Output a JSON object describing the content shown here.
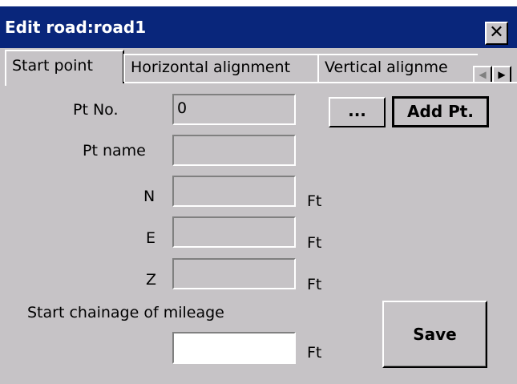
{
  "window": {
    "title": "Edit road:road1",
    "close_glyph": "✕"
  },
  "tabs": [
    {
      "label": "Start point",
      "active": true
    },
    {
      "label": "Horizontal alignment",
      "active": false
    },
    {
      "label": "Vertical alignme",
      "active": false
    }
  ],
  "tab_scroll": {
    "left_icon": "◀",
    "right_icon": "▶"
  },
  "form": {
    "pt_no_label": "Pt No.",
    "pt_no_value": "0",
    "pt_name_label": "Pt name",
    "pt_name_value": "",
    "n_label": "N",
    "n_value": "",
    "e_label": "E",
    "e_value": "",
    "z_label": "Z",
    "z_value": "",
    "chainage_label": "Start chainage of mileage",
    "chainage_value": "",
    "unit": "Ft"
  },
  "buttons": {
    "browse_label": "...",
    "add_pt_label": "Add Pt.",
    "save_label": "Save"
  },
  "colors": {
    "titlebar": "#09267b",
    "face": "#c6c3c6"
  }
}
